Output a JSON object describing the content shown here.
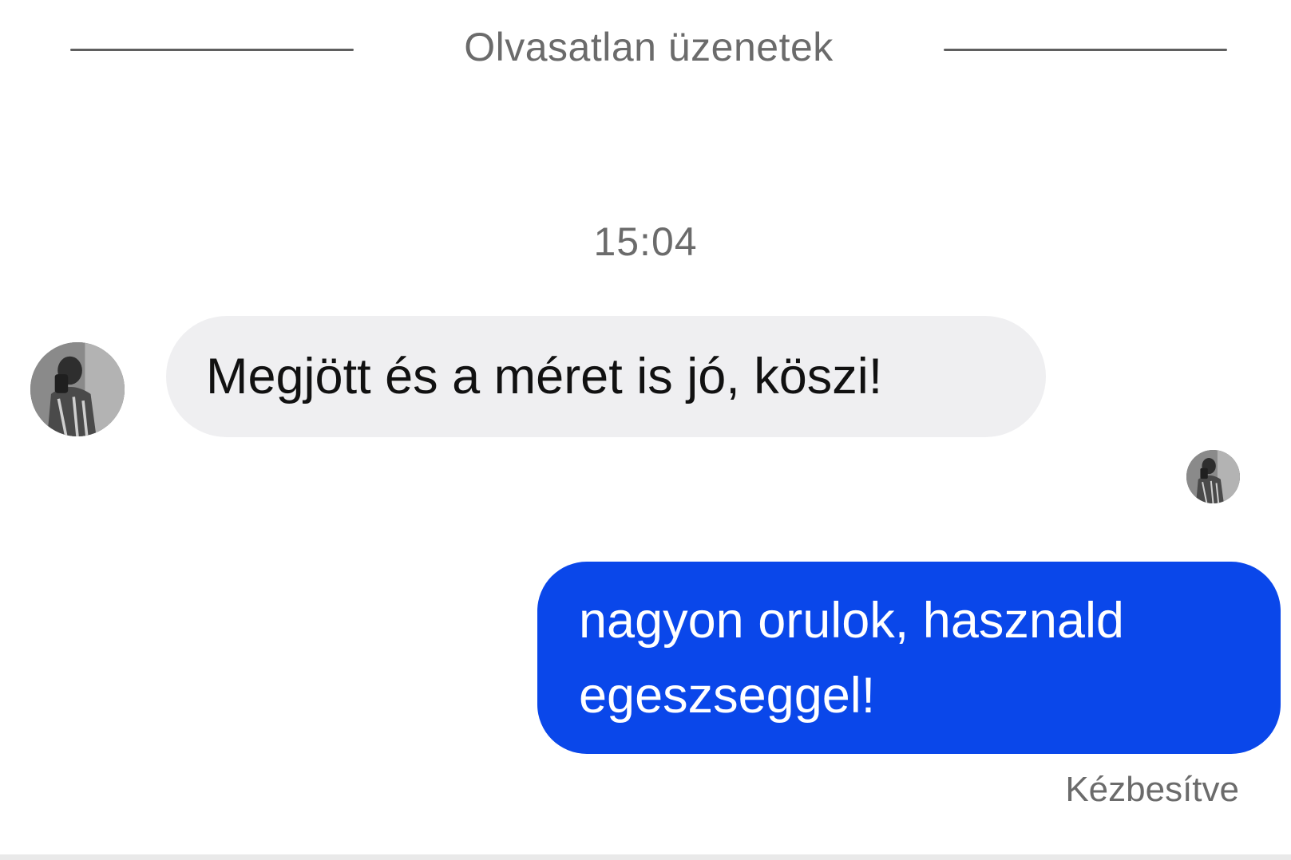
{
  "chat": {
    "unread_divider": "Olvasatlan üzenetek",
    "timestamp": "15:04",
    "messages": [
      {
        "direction": "incoming",
        "text": "Megjött és a méret is jó, köszi!"
      },
      {
        "direction": "outgoing",
        "text": "nagyon orulok, hasznald egeszseggel!"
      }
    ],
    "delivery_status": "Kézbesítve"
  },
  "colors": {
    "incoming_bubble": "#efeff1",
    "outgoing_bubble": "#0a47ea",
    "meta_text": "#6b6b6b"
  },
  "icons": {
    "contact_avatar": "contact-avatar-photo",
    "seen_indicator": "seen-avatar-photo"
  }
}
